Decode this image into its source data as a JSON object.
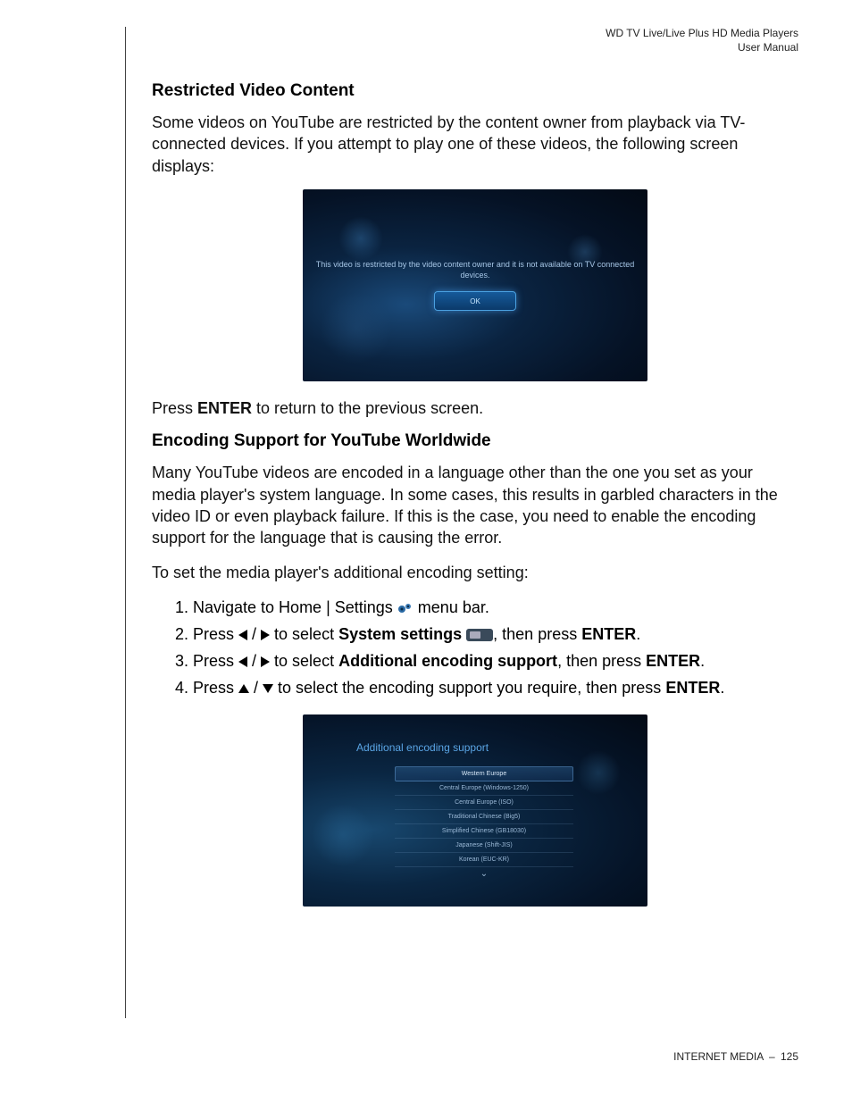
{
  "header": {
    "line1": "WD TV Live/Live Plus HD Media Players",
    "line2": "User Manual"
  },
  "section1": {
    "heading": "Restricted Video Content",
    "para1": "Some videos on YouTube are restricted by the content owner from playback via TV-connected devices. If you attempt to play one of these videos, the following screen displays:",
    "dialogText": "This video is restricted by the video content owner and it is not available on TV connected devices.",
    "dialogButton": "OK",
    "para2_pre": "Press ",
    "para2_enter": "ENTER",
    "para2_post": " to return to the previous screen."
  },
  "section2": {
    "heading": "Encoding Support for YouTube Worldwide",
    "para1": "Many YouTube videos are encoded in a language other than the one you set as your media player's system language. In some cases, this results in garbled characters in the video ID or even playback failure. If this is the case, you need to enable the encoding support for the language that is causing the error.",
    "para2": "To set the media player's additional encoding setting:",
    "steps": {
      "s1_pre": "Navigate to Home | Settings ",
      "s1_post": " menu bar.",
      "s2_pre": "Press ",
      "s2_mid": " to select ",
      "s2_bold": "System settings",
      "s2_then": ", then press ",
      "s2_enter": "ENTER",
      "s2_end": ".",
      "s3_pre": "Press ",
      "s3_mid": " to select ",
      "s3_bold": "Additional encoding support",
      "s3_then": ", then press ",
      "s3_enter": "ENTER",
      "s3_end": ".",
      "s4_pre": "Press ",
      "s4_mid": " to select the encoding support you require, then press ",
      "s4_enter": "ENTER",
      "s4_end": "."
    },
    "screenshot": {
      "title": "Additional encoding support",
      "rows": [
        "Western Europe",
        "Central Europe (Windows-1250)",
        "Central Europe (ISO)",
        "Traditional Chinese (Big5)",
        "Simplified Chinese (GB18030)",
        "Japanese (Shift-JIS)",
        "Korean (EUC-KR)"
      ],
      "selectedIndex": 0
    }
  },
  "footer": {
    "section": "INTERNET MEDIA",
    "sep": "–",
    "page": "125"
  }
}
